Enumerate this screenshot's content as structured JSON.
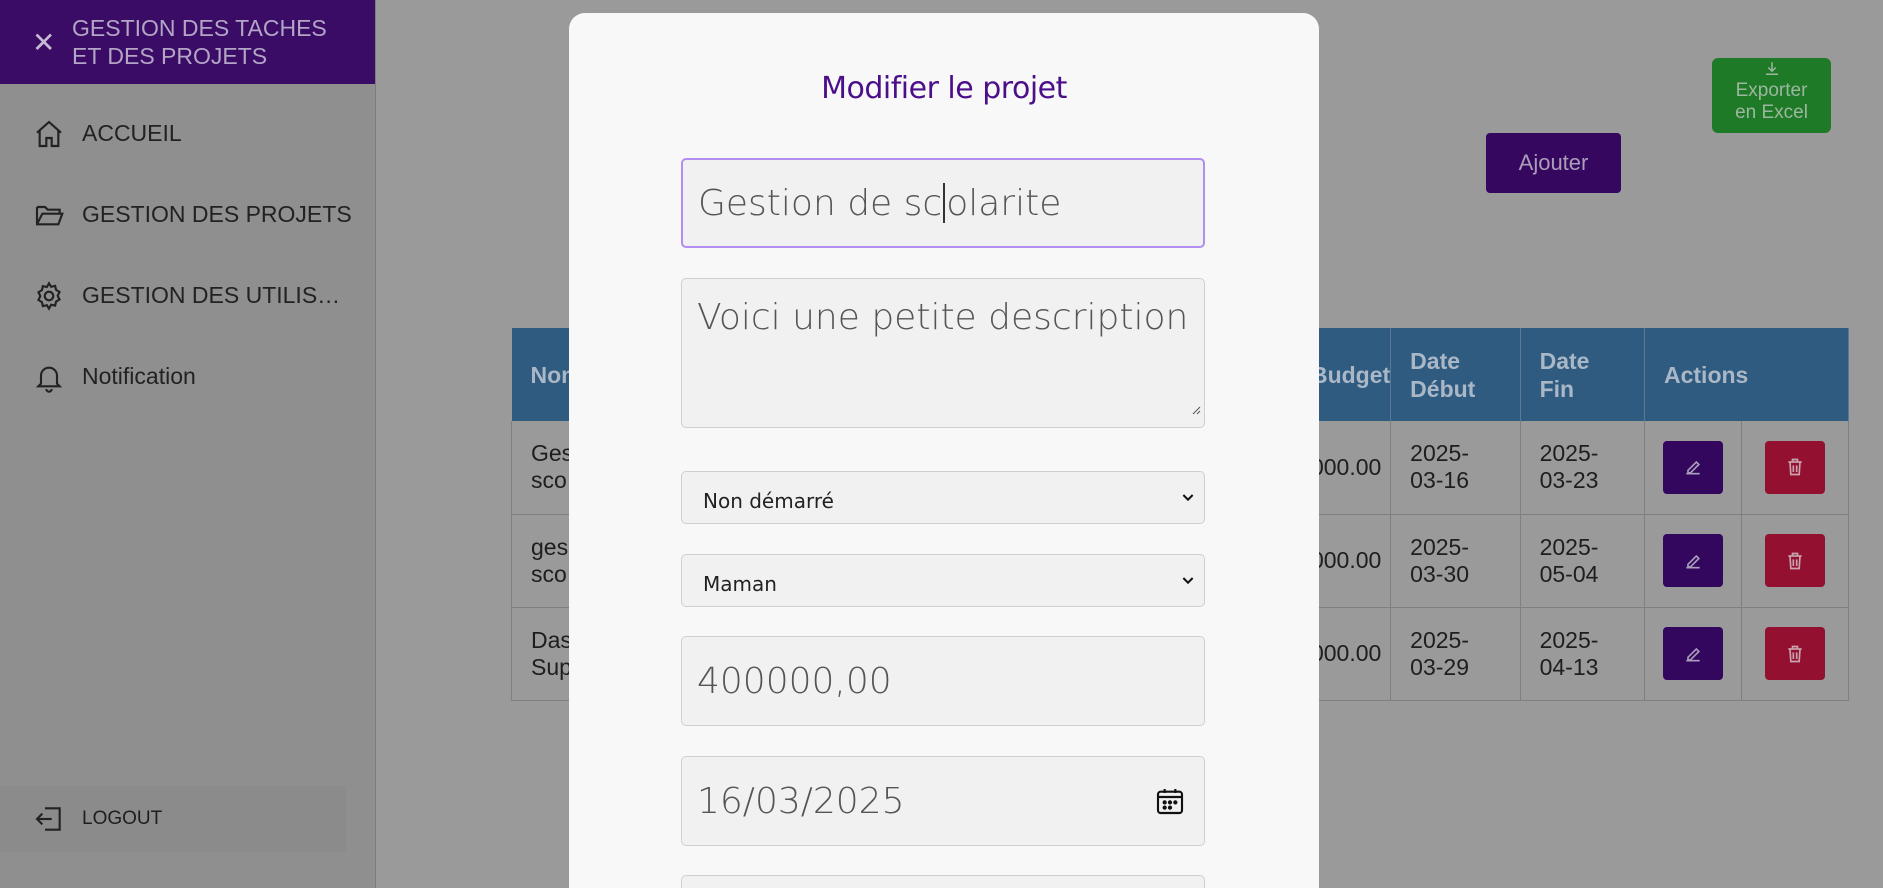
{
  "sidebar": {
    "brand_title_line1": "GESTION DES TACHES",
    "brand_title_line2": "ET DES PROJETS",
    "close_icon": "close-icon",
    "items": [
      {
        "label": "ACCUEIL",
        "icon": "home-icon"
      },
      {
        "label": "GESTION DES PROJETS",
        "icon": "folder-icon"
      },
      {
        "label": "GESTION DES UTILISATEURS",
        "icon": "gear-icon"
      },
      {
        "label": "Notification",
        "icon": "bell-icon"
      }
    ],
    "logout_label": "LOGOUT"
  },
  "toolbar": {
    "export_label_line1": "Exporter",
    "export_label_line2": "en Excel",
    "add_label": "Ajouter"
  },
  "table": {
    "headers": [
      "Nom",
      "Budget",
      "Date Début",
      "Date Fin",
      "Actions"
    ],
    "header_date_debut_1": "Date",
    "header_date_debut_2": "Début",
    "header_date_fin_1": "Date",
    "header_date_fin_2": "Fin",
    "rows": [
      {
        "name_1": "Ges",
        "name_2": "sco",
        "budget": "000.00",
        "start_1": "2025-",
        "start_2": "03-16",
        "end_1": "2025-",
        "end_2": "03-23"
      },
      {
        "name_1": "ges",
        "name_2": "sco",
        "budget": "000.00",
        "start_1": "2025-",
        "start_2": "03-30",
        "end_1": "2025-",
        "end_2": "05-04"
      },
      {
        "name_1": "Das",
        "name_2": "Sup",
        "budget": "000.00",
        "start_1": "2025-",
        "start_2": "03-29",
        "end_1": "2025-",
        "end_2": "04-13"
      }
    ]
  },
  "modal": {
    "title": "Modifier le projet",
    "name_value_before_caret": "Gestion de sc",
    "name_value_after_caret": "olarite",
    "description_value": "Voici une petite description",
    "status_selected": "Non démarré",
    "user_selected": "Maman",
    "budget_value": "400000,00",
    "start_date_value": "16/03/2025"
  },
  "colors": {
    "brand_purple": "#3a0c66",
    "title_purple": "#4b0f8a",
    "export_green": "#1e7a27",
    "delete_red": "#931030",
    "table_header_blue": "#2f5b80",
    "focus_border": "#b28ef0"
  }
}
